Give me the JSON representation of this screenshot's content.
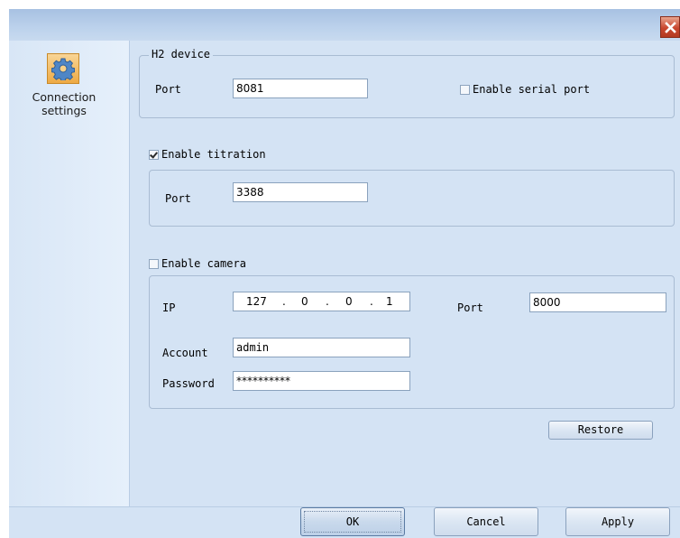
{
  "window": {
    "close_icon": "close-icon"
  },
  "sidebar": {
    "items": [
      {
        "label_line1": "Connection",
        "label_line2": "settings",
        "icon": "gear-icon"
      }
    ]
  },
  "h2_device": {
    "legend": "H2 device",
    "port_label": "Port",
    "port_value": "8081",
    "serial_label": "Enable serial port",
    "serial_checked": false
  },
  "titration": {
    "enable_label": "Enable titration",
    "enabled": true,
    "port_label": "Port",
    "port_value": "3388"
  },
  "camera": {
    "enable_label": "Enable camera",
    "enabled": false,
    "ip_label": "IP",
    "ip": {
      "o1": "127",
      "o2": "0",
      "o3": "0",
      "o4": "1",
      "dot": "."
    },
    "port_label": "Port",
    "port_value": "8000",
    "account_label": "Account",
    "account_value": "admin",
    "password_label": "Password",
    "password_value": "**********"
  },
  "buttons": {
    "restore": "Restore",
    "ok": "OK",
    "cancel": "Cancel",
    "apply": "Apply"
  },
  "colors": {
    "accent": "#cfdff0",
    "close": "#c9472f",
    "icon": "#eeaa44"
  }
}
